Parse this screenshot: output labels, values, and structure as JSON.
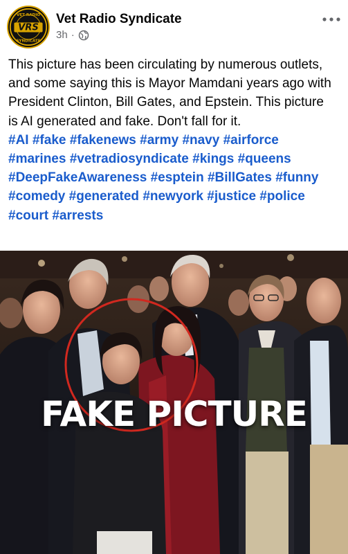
{
  "post": {
    "author": "Vet Radio Syndicate",
    "time": "3h",
    "separator": "·",
    "privacy_icon": "globe-icon",
    "menu_icon": "more-horizontal-icon",
    "avatar": {
      "logo_text": "VRS",
      "ring_text_top": "VET RADIO",
      "ring_text_bottom": "SYNDICATE"
    },
    "text": "This picture has been circulating by numerous outlets, and some saying this is Mayor Mamdani years ago with President Clinton, Bill Gates, and Epstein. This picture is AI generated and fake. Don't fall for it.",
    "hashtags": [
      "#AI",
      "#fake",
      "#fakenews",
      "#army",
      "#navy",
      "#airforce",
      "#marines",
      "#vetradiosyndicate",
      "#kings",
      "#queens",
      "#DeepFakeAwareness",
      "#esptein",
      "#BillGates",
      "#funny",
      "#comedy",
      "#generated",
      "#newyork",
      "#justice",
      "#police",
      "#court",
      "#arrests"
    ],
    "image": {
      "overlay_text": "FAKE PICTURE",
      "circle_color": "#d1281f"
    }
  },
  "colors": {
    "link": "#1a5ccc",
    "text": "#050505",
    "meta": "#65676b",
    "avatar_gold": "#d9a400"
  }
}
